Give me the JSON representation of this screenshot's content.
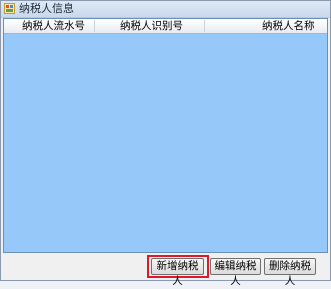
{
  "window": {
    "title": "纳税人信息",
    "icon": "app-form-icon"
  },
  "table": {
    "columns": [
      "纳税人流水号",
      "纳税人识别号",
      "纳税人名称"
    ],
    "rows": []
  },
  "buttons": {
    "add": "新增纳税人",
    "edit": "编辑纳税人",
    "delete": "删除纳税人"
  },
  "colors": {
    "grid_background": "#96c8fa",
    "highlight": "#e0192a"
  }
}
